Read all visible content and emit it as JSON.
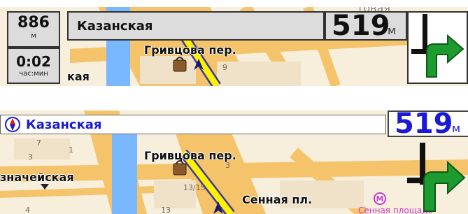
{
  "panel1": {
    "distance_total": {
      "value": "886",
      "unit": "м"
    },
    "time_remaining": {
      "value": "0:02",
      "unit": "час:мин"
    },
    "current_street": "Казанская",
    "next_distance": {
      "value": "519",
      "unit": "м"
    },
    "map_labels": {
      "street1": "Гривцова пер.",
      "street_partial": "кая",
      "top_partial": "товая",
      "house_9": "9"
    }
  },
  "panel2": {
    "current_street": "Казанская",
    "next_distance": {
      "value": "519",
      "unit": "м"
    },
    "map_labels": {
      "street1": "Гривцова пер.",
      "street_left": "значейская",
      "square": "Сенная пл.",
      "metro_station": "Сенная площадь",
      "metro_symbol": "М",
      "house_1": "1",
      "house_3": "3",
      "house_7": "7",
      "house_4": "4",
      "house_13": "13",
      "house_13_15": "13/15",
      "house_3b": "3"
    }
  },
  "colors": {
    "map_bg": "#f7eedb",
    "road": "#f5c36a",
    "canal": "#79b7ff",
    "route": "#fff100",
    "turn_arrow": "#1e9b2f",
    "accent_blue": "#1a1ad6",
    "metro": "#c53ac9"
  },
  "icons": {
    "turn": "turn-right-arrow-icon",
    "compass": "compass-icon",
    "poi": "shopping-bag-icon",
    "position": "position-arrow-icon",
    "metro": "metro-m-icon"
  }
}
